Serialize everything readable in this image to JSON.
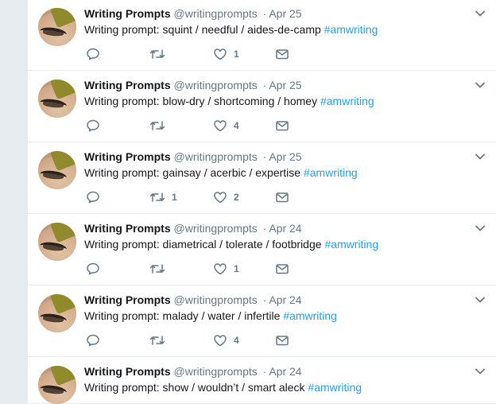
{
  "tweets": [
    {
      "author_name": "Writing Prompts",
      "handle": "@writingprompts",
      "separator": "·",
      "date": "Apr 25",
      "text": "Writing prompt: squint / needful / aides-de-camp",
      "hashtag": "#amwriting",
      "retweets": "",
      "likes": "1"
    },
    {
      "author_name": "Writing Prompts",
      "handle": "@writingprompts",
      "separator": "·",
      "date": "Apr 25",
      "text": "Writing prompt: blow-dry / shortcoming / homey",
      "hashtag": "#amwriting",
      "retweets": "",
      "likes": "4"
    },
    {
      "author_name": "Writing Prompts",
      "handle": "@writingprompts",
      "separator": "·",
      "date": "Apr 25",
      "text": "Writing prompt: gainsay / acerbic / expertise",
      "hashtag": "#amwriting",
      "retweets": "1",
      "likes": "2"
    },
    {
      "author_name": "Writing Prompts",
      "handle": "@writingprompts",
      "separator": "·",
      "date": "Apr 24",
      "text": "Writing prompt: diametrical / tolerate / footbridge",
      "hashtag": "#amwriting",
      "retweets": "",
      "likes": "1"
    },
    {
      "author_name": "Writing Prompts",
      "handle": "@writingprompts",
      "separator": "·",
      "date": "Apr 24",
      "text": "Writing prompt: malady / water / infertile",
      "hashtag": "#amwriting",
      "retweets": "",
      "likes": "4"
    },
    {
      "author_name": "Writing Prompts",
      "handle": "@writingprompts",
      "separator": "·",
      "date": "Apr 24",
      "text": "Writing prompt: show / wouldn’t / smart aleck",
      "hashtag": "#amwriting",
      "retweets": "",
      "likes": ""
    }
  ],
  "icons": {
    "reply": "reply-icon",
    "retweet": "retweet-icon",
    "like": "heart-icon",
    "message": "direct-message-icon",
    "menu": "chevron-down-icon"
  },
  "colors": {
    "hashtag": "#1da1f2",
    "secondary_text": "#657786",
    "primary_text": "#14171a",
    "background": "#e6ecf0"
  }
}
